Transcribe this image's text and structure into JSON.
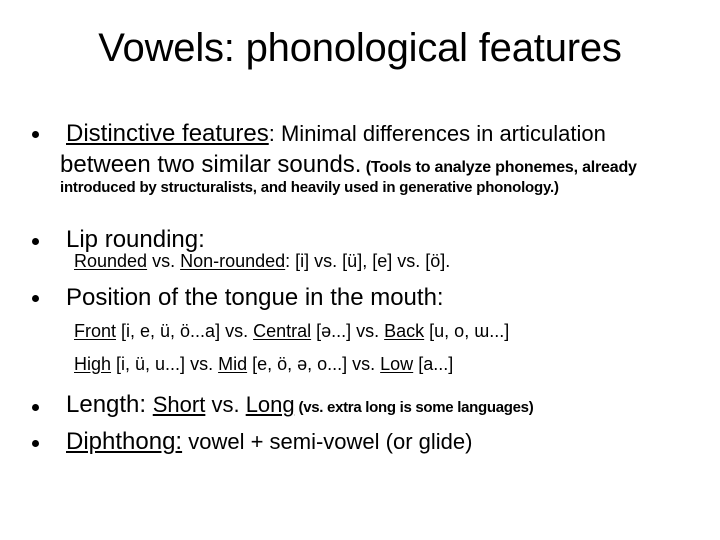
{
  "title": "Vowels: phonological features",
  "items": [
    {
      "term": "Distinctive features",
      "text": ": Minimal differences in articulation",
      "line2": "between two similar sounds.",
      "line2_small": " (Tools to analyze phonemes, already",
      "line3": "introduced by structuralists, and heavily used in generative phonology.)"
    },
    {
      "text": "Lip rounding:",
      "sub": {
        "term1": "Rounded",
        "vs1": " vs. ",
        "term2": "Non-rounded",
        "rest": ": [i] vs. [ü], [e] vs. [ö]."
      }
    },
    {
      "text": "Position of the tongue in the mouth:",
      "sub1": {
        "t1": "Front",
        "r1": " [i, e, ü, ö...a] vs. ",
        "t2": "Central",
        "r2": " [ə...] vs. ",
        "t3": "Back",
        "r3": " [u, o, ɯ...]"
      },
      "sub2": {
        "t1": "High",
        "r1": " [i, ü, u...] vs. ",
        "t2": "Mid",
        "r2": " [e, ö, ə, o...] vs. ",
        "t3": "Low",
        "r3": " [a...]"
      }
    },
    {
      "text": "Length: ",
      "term1": "Short",
      "vs": " vs. ",
      "term2": "Long",
      "note": " (vs. extra long is some languages)"
    },
    {
      "term": "Diphthong:",
      "text": " vowel + semi-vowel (or glide)"
    }
  ]
}
